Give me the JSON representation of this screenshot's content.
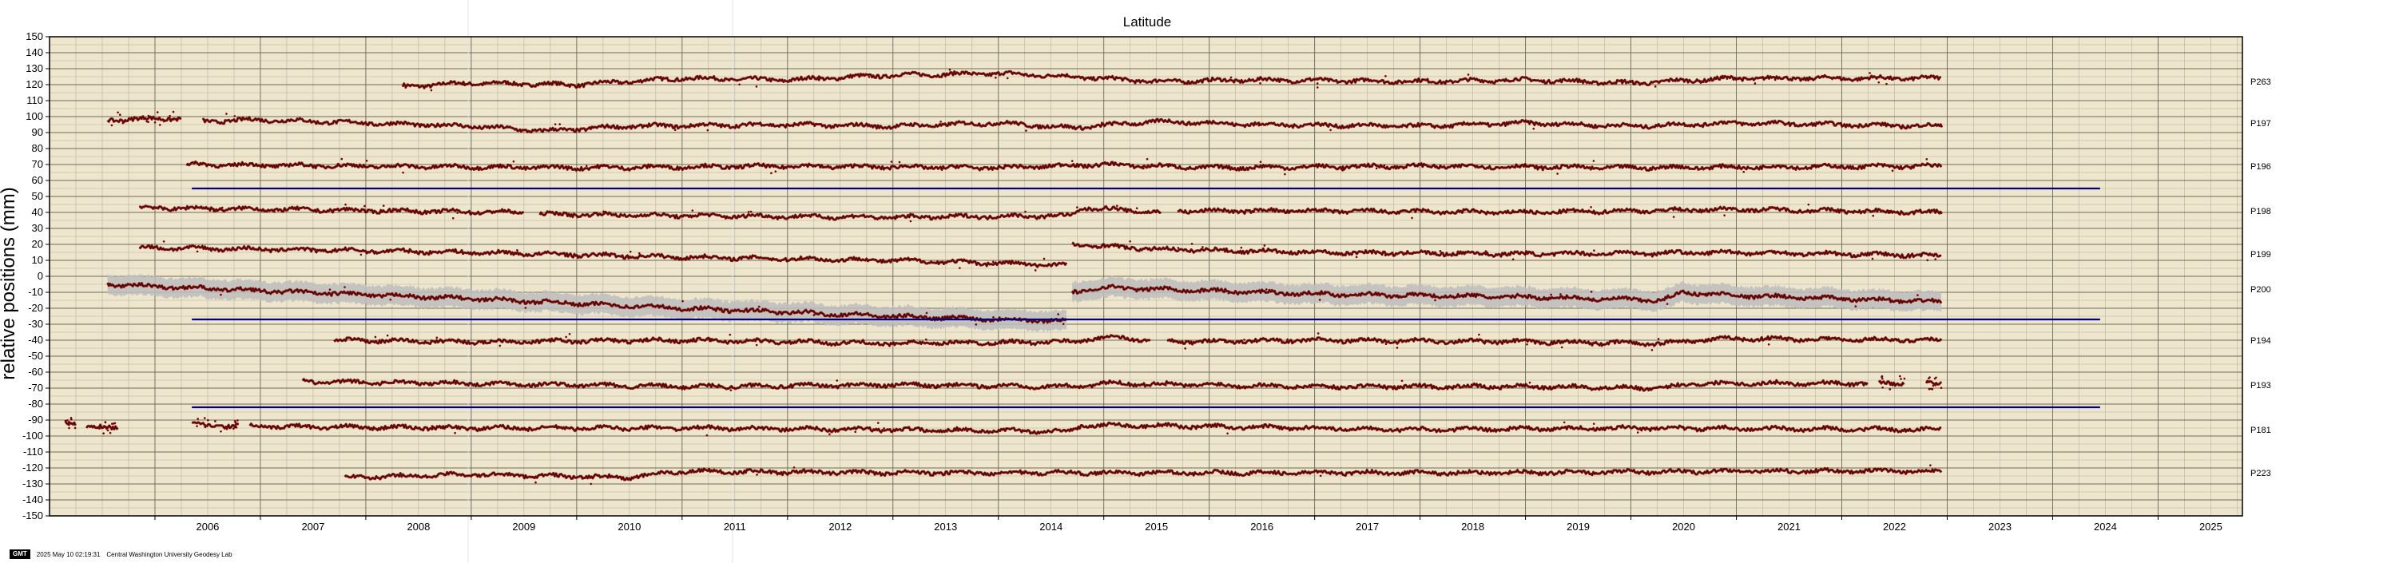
{
  "chart_data": {
    "type": "line",
    "title": "Latitude",
    "xlabel": "",
    "ylabel": "relative positions (mm)",
    "xlim": [
      2005.0,
      2025.8
    ],
    "ylim": [
      -150,
      150
    ],
    "x_ticks": [
      "2006",
      "2007",
      "2008",
      "2009",
      "2010",
      "2011",
      "2012",
      "2013",
      "2014",
      "2015",
      "2016",
      "2017",
      "2018",
      "2019",
      "2020",
      "2021",
      "2022",
      "2023",
      "2024",
      "2025"
    ],
    "y_ticks": [
      150,
      140,
      130,
      120,
      110,
      100,
      90,
      80,
      70,
      60,
      50,
      40,
      30,
      20,
      10,
      0,
      -10,
      -20,
      -30,
      -40,
      -50,
      -60,
      -70,
      -80,
      -90,
      -100,
      -110,
      -120,
      -130,
      -140,
      -150
    ],
    "grid": true,
    "background_color": "#ede5cc",
    "series_color": "#7a0000",
    "uncertainty_color": "#bdbdbd",
    "reference_line_color": "#000080",
    "reference_lines": [
      {
        "y": 55,
        "x_start": 2006.35,
        "x_end": 2024.45
      },
      {
        "y": -27,
        "x_start": 2006.35,
        "x_end": 2024.45
      },
      {
        "y": -82,
        "x_start": 2006.35,
        "x_end": 2024.45
      }
    ],
    "series": [
      {
        "name": "P263",
        "offset": 122,
        "segments": [
          [
            2008.35,
            2022.95
          ]
        ],
        "trend": [
          [
            2008.35,
            119
          ],
          [
            2009.0,
            121
          ],
          [
            2010.0,
            120
          ],
          [
            2011.0,
            124
          ],
          [
            2012.0,
            123
          ],
          [
            2013.0,
            126
          ],
          [
            2014.0,
            127
          ],
          [
            2014.7,
            125
          ],
          [
            2015.5,
            122
          ],
          [
            2016.5,
            123
          ],
          [
            2018.0,
            122
          ],
          [
            2019.0,
            123
          ],
          [
            2020.0,
            121
          ],
          [
            2021.0,
            124
          ],
          [
            2022.95,
            124
          ]
        ]
      },
      {
        "name": "P197",
        "offset": 96,
        "segments": [
          [
            2005.55,
            2006.25
          ],
          [
            2006.45,
            2022.95
          ]
        ],
        "trend": [
          [
            2005.55,
            98
          ],
          [
            2006.25,
            99
          ],
          [
            2006.45,
            97
          ],
          [
            2007.0,
            98
          ],
          [
            2008.0,
            96
          ],
          [
            2009.0,
            94
          ],
          [
            2009.7,
            91
          ],
          [
            2010.5,
            94
          ],
          [
            2012.0,
            95
          ],
          [
            2013.0,
            94
          ],
          [
            2014.0,
            96
          ],
          [
            2014.7,
            93
          ],
          [
            2015.5,
            97
          ],
          [
            2016.5,
            95
          ],
          [
            2018.0,
            94
          ],
          [
            2019.0,
            96
          ],
          [
            2020.0,
            94
          ],
          [
            2021.0,
            96
          ],
          [
            2022.95,
            94
          ]
        ]
      },
      {
        "name": "P196",
        "offset": 69,
        "segments": [
          [
            2006.3,
            2022.95
          ]
        ],
        "trend": [
          [
            2006.3,
            70
          ],
          [
            2008.0,
            69
          ],
          [
            2010.0,
            68
          ],
          [
            2012.0,
            69
          ],
          [
            2014.0,
            68
          ],
          [
            2015.0,
            70
          ],
          [
            2016.0,
            68
          ],
          [
            2018.0,
            69
          ],
          [
            2020.0,
            68
          ],
          [
            2022.95,
            69
          ]
        ]
      },
      {
        "name": "P198",
        "offset": 41,
        "segments": [
          [
            2005.85,
            2009.5
          ],
          [
            2009.65,
            2015.55
          ],
          [
            2015.7,
            2022.95
          ]
        ],
        "trend": [
          [
            2005.85,
            43
          ],
          [
            2007.0,
            42
          ],
          [
            2009.5,
            40
          ],
          [
            2009.65,
            39
          ],
          [
            2011.0,
            38
          ],
          [
            2013.0,
            37
          ],
          [
            2014.7,
            38
          ],
          [
            2014.8,
            43
          ],
          [
            2015.55,
            40
          ],
          [
            2015.7,
            41
          ],
          [
            2017.0,
            41
          ],
          [
            2019.0,
            40
          ],
          [
            2021.0,
            42
          ],
          [
            2022.95,
            40
          ]
        ]
      },
      {
        "name": "P199",
        "offset": 14,
        "segments": [
          [
            2005.85,
            2014.65
          ],
          [
            2014.7,
            2022.95
          ]
        ],
        "trend": [
          [
            2005.85,
            18
          ],
          [
            2007.0,
            17
          ],
          [
            2009.0,
            15
          ],
          [
            2011.0,
            12
          ],
          [
            2013.0,
            10
          ],
          [
            2014.65,
            7
          ],
          [
            2014.7,
            20
          ],
          [
            2015.5,
            17
          ],
          [
            2017.0,
            15
          ],
          [
            2019.0,
            14
          ],
          [
            2021.0,
            15
          ],
          [
            2022.95,
            13
          ]
        ]
      },
      {
        "name": "P200",
        "offset": -8,
        "band": 6,
        "segments": [
          [
            2005.55,
            2014.65
          ],
          [
            2014.7,
            2022.95
          ]
        ],
        "trend": [
          [
            2005.55,
            -5
          ],
          [
            2007.0,
            -9
          ],
          [
            2009.0,
            -14
          ],
          [
            2011.0,
            -20
          ],
          [
            2013.0,
            -25
          ],
          [
            2014.65,
            -28
          ],
          [
            2014.7,
            -10
          ],
          [
            2015.0,
            -7
          ],
          [
            2017.0,
            -11
          ],
          [
            2019.0,
            -13
          ],
          [
            2020.3,
            -15
          ],
          [
            2020.5,
            -10
          ],
          [
            2021.0,
            -12
          ],
          [
            2022.95,
            -16
          ]
        ]
      },
      {
        "name": "P194",
        "offset": -40,
        "segments": [
          [
            2007.7,
            2015.45
          ],
          [
            2015.6,
            2022.95
          ]
        ],
        "trend": [
          [
            2007.7,
            -40
          ],
          [
            2009.0,
            -41
          ],
          [
            2011.0,
            -40
          ],
          [
            2013.0,
            -42
          ],
          [
            2014.7,
            -41
          ],
          [
            2015.0,
            -38
          ],
          [
            2015.45,
            -40
          ],
          [
            2015.6,
            -41
          ],
          [
            2017.0,
            -40
          ],
          [
            2019.0,
            -41
          ],
          [
            2020.3,
            -42
          ],
          [
            2020.6,
            -40
          ],
          [
            2021.0,
            -39
          ],
          [
            2022.95,
            -40
          ]
        ]
      },
      {
        "name": "P193",
        "offset": -68,
        "segments": [
          [
            2007.4,
            2022.25
          ],
          [
            2022.35,
            2022.6
          ],
          [
            2022.8,
            2022.95
          ]
        ],
        "trend": [
          [
            2007.4,
            -66
          ],
          [
            2009.0,
            -67
          ],
          [
            2011.0,
            -69
          ],
          [
            2013.0,
            -68
          ],
          [
            2014.7,
            -69
          ],
          [
            2015.0,
            -67
          ],
          [
            2017.0,
            -69
          ],
          [
            2019.0,
            -69
          ],
          [
            2020.3,
            -70
          ],
          [
            2020.6,
            -67
          ],
          [
            2022.95,
            -67
          ]
        ]
      },
      {
        "name": "P181",
        "offset": -96,
        "segments": [
          [
            2006.35,
            2006.8
          ],
          [
            2006.9,
            2022.95
          ]
        ],
        "trend": [
          [
            2006.35,
            -93
          ],
          [
            2007.0,
            -94
          ],
          [
            2009.0,
            -95
          ],
          [
            2011.0,
            -95
          ],
          [
            2013.0,
            -96
          ],
          [
            2014.7,
            -97
          ],
          [
            2014.8,
            -93
          ],
          [
            2016.0,
            -94
          ],
          [
            2018.0,
            -96
          ],
          [
            2020.0,
            -95
          ],
          [
            2022.95,
            -96
          ]
        ]
      },
      {
        "name": "P223",
        "offset": -123,
        "segments": [
          [
            2005.15,
            2005.25
          ],
          [
            2005.35,
            2005.65
          ],
          [
            2007.8,
            2022.95
          ]
        ],
        "trend": [
          [
            2005.15,
            -91
          ],
          [
            2005.25,
            -92
          ],
          [
            2005.35,
            -95
          ],
          [
            2005.65,
            -94
          ],
          [
            2007.8,
            -126
          ],
          [
            2009.0,
            -124
          ],
          [
            2010.5,
            -126
          ],
          [
            2011.0,
            -122
          ],
          [
            2013.0,
            -123
          ],
          [
            2015.0,
            -123
          ],
          [
            2017.0,
            -123
          ],
          [
            2019.0,
            -123
          ],
          [
            2021.0,
            -122
          ],
          [
            2022.95,
            -122
          ]
        ]
      }
    ]
  },
  "footer": {
    "logo": "GMT",
    "timestamp": "2025 May 10 02:19:31",
    "credit": "Central Washington University Geodesy Lab"
  }
}
